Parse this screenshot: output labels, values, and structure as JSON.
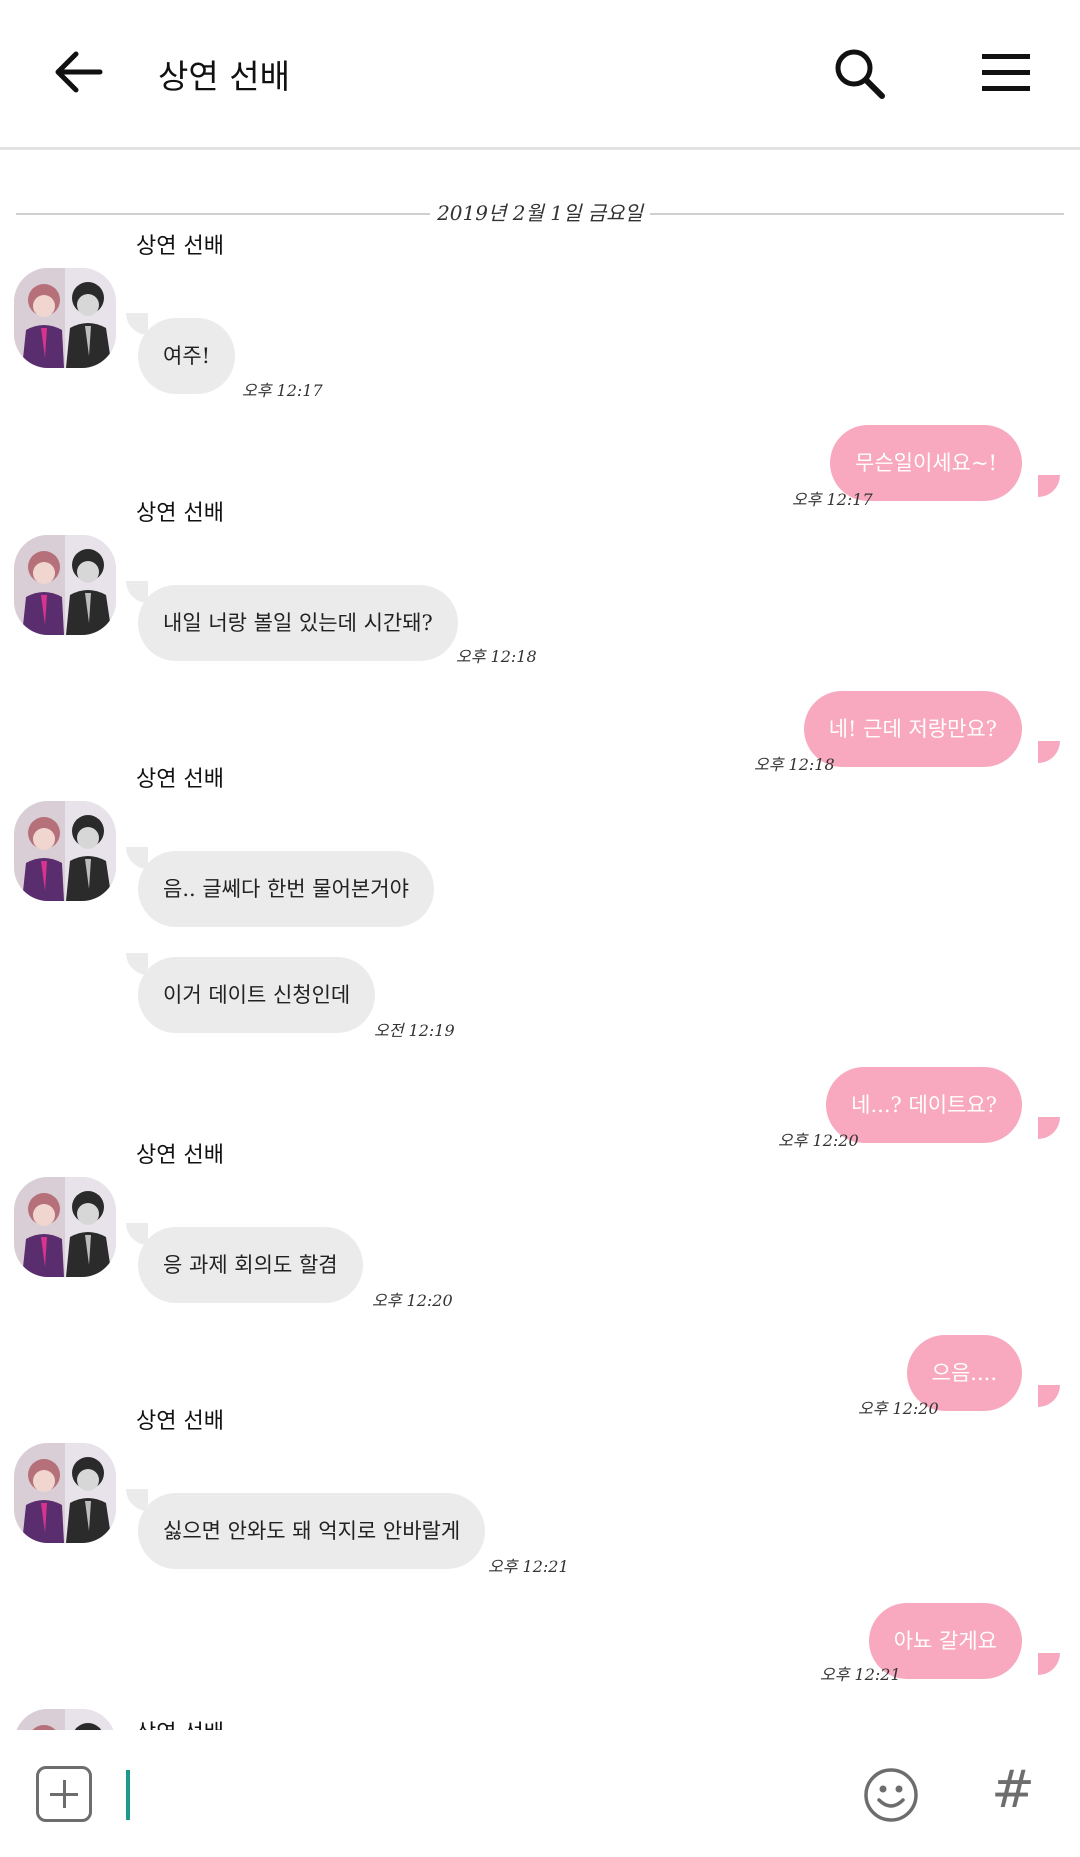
{
  "header": {
    "title": "상연 선배",
    "back_icon": "arrow-left-icon",
    "search_icon": "search-icon",
    "menu_icon": "hamburger-menu-icon"
  },
  "date_separator": "2019년 2월 1일 금요일",
  "sender_name": "상연 선배",
  "messages": [
    {
      "dir": "in",
      "text": "여주!",
      "time": "오후 12:17"
    },
    {
      "dir": "out",
      "text": "무슨일이세요~!",
      "time": "오후 12:17"
    },
    {
      "dir": "in",
      "text": "내일 너랑 볼일 있는데 시간돼?",
      "time": "오후 12:18"
    },
    {
      "dir": "out",
      "text": "네! 근데 저랑만요?",
      "time": "오후 12:18"
    },
    {
      "dir": "in",
      "text": "음.. 글쎄다 한번 물어본거야",
      "time": ""
    },
    {
      "dir": "in",
      "text": "이거 데이트 신청인데",
      "time": "오전 12:19"
    },
    {
      "dir": "out",
      "text": "네...? 데이트요?",
      "time": "오후 12:20"
    },
    {
      "dir": "in",
      "text": "응 과제 회의도 할겸",
      "time": "오후 12:20"
    },
    {
      "dir": "out",
      "text": "으음....",
      "time": "오후 12:20"
    },
    {
      "dir": "in",
      "text": "싫으면 안와도 돼 억지로 안바랄게",
      "time": "오후 12:21"
    },
    {
      "dir": "out",
      "text": "아뇨 갈게요",
      "time": "오후 12:21"
    }
  ],
  "input": {
    "placeholder": "",
    "add_icon": "plus-box-icon",
    "emoji_icon": "smiley-icon",
    "hash_icon": "hashtag-icon",
    "hash_label": "#"
  },
  "colors": {
    "incoming_bubble": "#ebebeb",
    "outgoing_bubble": "#f8a9bf",
    "caret": "#1e9a8a"
  }
}
